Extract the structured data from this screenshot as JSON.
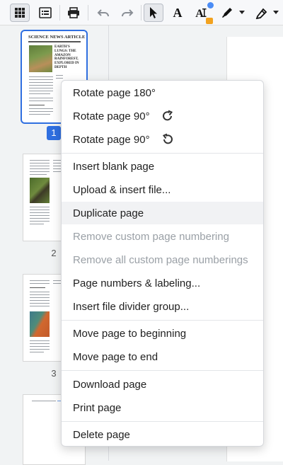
{
  "toolbar": {
    "icons": [
      "grid-view-icon",
      "list-view-icon",
      "print-icon",
      "undo-icon",
      "redo-icon",
      "select-arrow-icon",
      "text-icon",
      "text-locked-icon",
      "pen-icon",
      "highlighter-icon"
    ]
  },
  "thumbnails": {
    "page1": {
      "number": "1",
      "masthead": "SCIENCE NEWS ARTICLE",
      "headline": "EARTH'S LUNGS: THE AMAZON RAINFOREST, EXPLORED IN DEPTH"
    },
    "page2": {
      "number": "2"
    },
    "page3": {
      "number": "3"
    }
  },
  "menu": {
    "rotate180": "Rotate page 180°",
    "rotate90cw": "Rotate page 90°",
    "rotate90ccw": "Rotate page 90°",
    "insert_blank": "Insert blank page",
    "upload_insert": "Upload & insert file...",
    "duplicate": "Duplicate page",
    "remove_custom_numbering": "Remove custom page numbering",
    "remove_all_custom_numberings": "Remove all custom page numberings",
    "page_numbers_labeling": "Page numbers & labeling...",
    "insert_divider": "Insert file divider group...",
    "move_beginning": "Move page to beginning",
    "move_end": "Move page to end",
    "download": "Download page",
    "print": "Print page",
    "delete": "Delete page"
  },
  "colors": {
    "accent": "#2f6fe0",
    "badge": "#f2a21f",
    "notification": "#4b8cf5"
  }
}
